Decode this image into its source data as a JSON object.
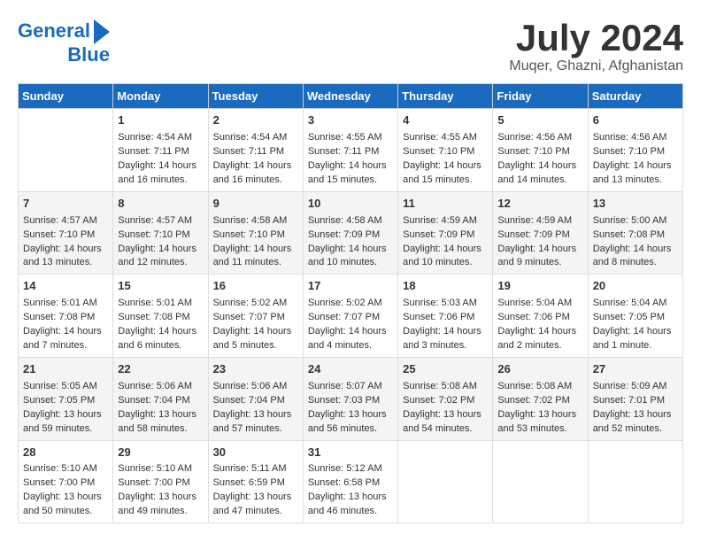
{
  "header": {
    "logo_line1": "General",
    "logo_line2": "Blue",
    "month": "July 2024",
    "location": "Muqer, Ghazni, Afghanistan"
  },
  "weekdays": [
    "Sunday",
    "Monday",
    "Tuesday",
    "Wednesday",
    "Thursday",
    "Friday",
    "Saturday"
  ],
  "weeks": [
    [
      {
        "day": "",
        "info": ""
      },
      {
        "day": "1",
        "info": "Sunrise: 4:54 AM\nSunset: 7:11 PM\nDaylight: 14 hours\nand 16 minutes."
      },
      {
        "day": "2",
        "info": "Sunrise: 4:54 AM\nSunset: 7:11 PM\nDaylight: 14 hours\nand 16 minutes."
      },
      {
        "day": "3",
        "info": "Sunrise: 4:55 AM\nSunset: 7:11 PM\nDaylight: 14 hours\nand 15 minutes."
      },
      {
        "day": "4",
        "info": "Sunrise: 4:55 AM\nSunset: 7:10 PM\nDaylight: 14 hours\nand 15 minutes."
      },
      {
        "day": "5",
        "info": "Sunrise: 4:56 AM\nSunset: 7:10 PM\nDaylight: 14 hours\nand 14 minutes."
      },
      {
        "day": "6",
        "info": "Sunrise: 4:56 AM\nSunset: 7:10 PM\nDaylight: 14 hours\nand 13 minutes."
      }
    ],
    [
      {
        "day": "7",
        "info": "Sunrise: 4:57 AM\nSunset: 7:10 PM\nDaylight: 14 hours\nand 13 minutes."
      },
      {
        "day": "8",
        "info": "Sunrise: 4:57 AM\nSunset: 7:10 PM\nDaylight: 14 hours\nand 12 minutes."
      },
      {
        "day": "9",
        "info": "Sunrise: 4:58 AM\nSunset: 7:10 PM\nDaylight: 14 hours\nand 11 minutes."
      },
      {
        "day": "10",
        "info": "Sunrise: 4:58 AM\nSunset: 7:09 PM\nDaylight: 14 hours\nand 10 minutes."
      },
      {
        "day": "11",
        "info": "Sunrise: 4:59 AM\nSunset: 7:09 PM\nDaylight: 14 hours\nand 10 minutes."
      },
      {
        "day": "12",
        "info": "Sunrise: 4:59 AM\nSunset: 7:09 PM\nDaylight: 14 hours\nand 9 minutes."
      },
      {
        "day": "13",
        "info": "Sunrise: 5:00 AM\nSunset: 7:08 PM\nDaylight: 14 hours\nand 8 minutes."
      }
    ],
    [
      {
        "day": "14",
        "info": "Sunrise: 5:01 AM\nSunset: 7:08 PM\nDaylight: 14 hours\nand 7 minutes."
      },
      {
        "day": "15",
        "info": "Sunrise: 5:01 AM\nSunset: 7:08 PM\nDaylight: 14 hours\nand 6 minutes."
      },
      {
        "day": "16",
        "info": "Sunrise: 5:02 AM\nSunset: 7:07 PM\nDaylight: 14 hours\nand 5 minutes."
      },
      {
        "day": "17",
        "info": "Sunrise: 5:02 AM\nSunset: 7:07 PM\nDaylight: 14 hours\nand 4 minutes."
      },
      {
        "day": "18",
        "info": "Sunrise: 5:03 AM\nSunset: 7:06 PM\nDaylight: 14 hours\nand 3 minutes."
      },
      {
        "day": "19",
        "info": "Sunrise: 5:04 AM\nSunset: 7:06 PM\nDaylight: 14 hours\nand 2 minutes."
      },
      {
        "day": "20",
        "info": "Sunrise: 5:04 AM\nSunset: 7:05 PM\nDaylight: 14 hours\nand 1 minute."
      }
    ],
    [
      {
        "day": "21",
        "info": "Sunrise: 5:05 AM\nSunset: 7:05 PM\nDaylight: 13 hours\nand 59 minutes."
      },
      {
        "day": "22",
        "info": "Sunrise: 5:06 AM\nSunset: 7:04 PM\nDaylight: 13 hours\nand 58 minutes."
      },
      {
        "day": "23",
        "info": "Sunrise: 5:06 AM\nSunset: 7:04 PM\nDaylight: 13 hours\nand 57 minutes."
      },
      {
        "day": "24",
        "info": "Sunrise: 5:07 AM\nSunset: 7:03 PM\nDaylight: 13 hours\nand 56 minutes."
      },
      {
        "day": "25",
        "info": "Sunrise: 5:08 AM\nSunset: 7:02 PM\nDaylight: 13 hours\nand 54 minutes."
      },
      {
        "day": "26",
        "info": "Sunrise: 5:08 AM\nSunset: 7:02 PM\nDaylight: 13 hours\nand 53 minutes."
      },
      {
        "day": "27",
        "info": "Sunrise: 5:09 AM\nSunset: 7:01 PM\nDaylight: 13 hours\nand 52 minutes."
      }
    ],
    [
      {
        "day": "28",
        "info": "Sunrise: 5:10 AM\nSunset: 7:00 PM\nDaylight: 13 hours\nand 50 minutes."
      },
      {
        "day": "29",
        "info": "Sunrise: 5:10 AM\nSunset: 7:00 PM\nDaylight: 13 hours\nand 49 minutes."
      },
      {
        "day": "30",
        "info": "Sunrise: 5:11 AM\nSunset: 6:59 PM\nDaylight: 13 hours\nand 47 minutes."
      },
      {
        "day": "31",
        "info": "Sunrise: 5:12 AM\nSunset: 6:58 PM\nDaylight: 13 hours\nand 46 minutes."
      },
      {
        "day": "",
        "info": ""
      },
      {
        "day": "",
        "info": ""
      },
      {
        "day": "",
        "info": ""
      }
    ]
  ]
}
